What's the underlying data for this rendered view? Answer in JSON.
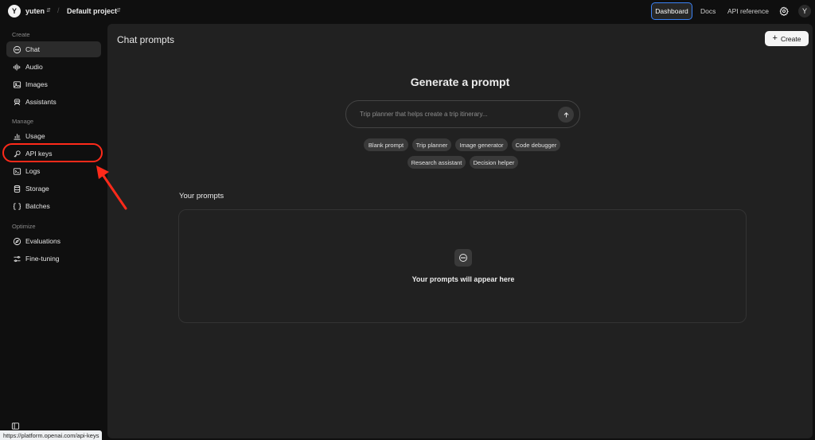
{
  "header": {
    "org_initial": "Y",
    "org_name": "yuten",
    "separator": "/",
    "project_name": "Default project",
    "dashboard_label": "Dashboard",
    "docs_label": "Docs",
    "api_reference_label": "API reference",
    "user_initial": "Y"
  },
  "sidebar": {
    "sections": {
      "create": "Create",
      "manage": "Manage",
      "optimize": "Optimize"
    },
    "items": [
      {
        "label": "Chat",
        "icon": "chat-bubble-icon"
      },
      {
        "label": "Audio",
        "icon": "audio-wave-icon"
      },
      {
        "label": "Images",
        "icon": "image-icon"
      },
      {
        "label": "Assistants",
        "icon": "assistant-icon"
      },
      {
        "label": "Usage",
        "icon": "usage-icon"
      },
      {
        "label": "API keys",
        "icon": "key-icon"
      },
      {
        "label": "Logs",
        "icon": "terminal-icon"
      },
      {
        "label": "Storage",
        "icon": "database-icon"
      },
      {
        "label": "Batches",
        "icon": "batches-icon"
      },
      {
        "label": "Evaluations",
        "icon": "compass-icon"
      },
      {
        "label": "Fine-tuning",
        "icon": "sliders-icon"
      }
    ],
    "active_item": "Chat",
    "highlighted_item": "API keys",
    "highlight_color": "#ff2a1a"
  },
  "status_bar": {
    "url": "https://platform.openai.com/api-keys"
  },
  "main": {
    "title": "Chat prompts",
    "create_label": "Create",
    "generate_title": "Generate a prompt",
    "input_placeholder": "Trip planner that helps create a trip itinerary...",
    "chips": [
      "Blank prompt",
      "Trip planner",
      "Image generator",
      "Code debugger",
      "Research assistant",
      "Decision helper"
    ],
    "your_prompts_label": "Your prompts",
    "empty_state_text": "Your prompts will appear here"
  },
  "colors": {
    "background": "#0f0f0f",
    "panel": "#212121",
    "accent_blue": "#3b82f6",
    "annotation_red": "#ff2a1a"
  }
}
